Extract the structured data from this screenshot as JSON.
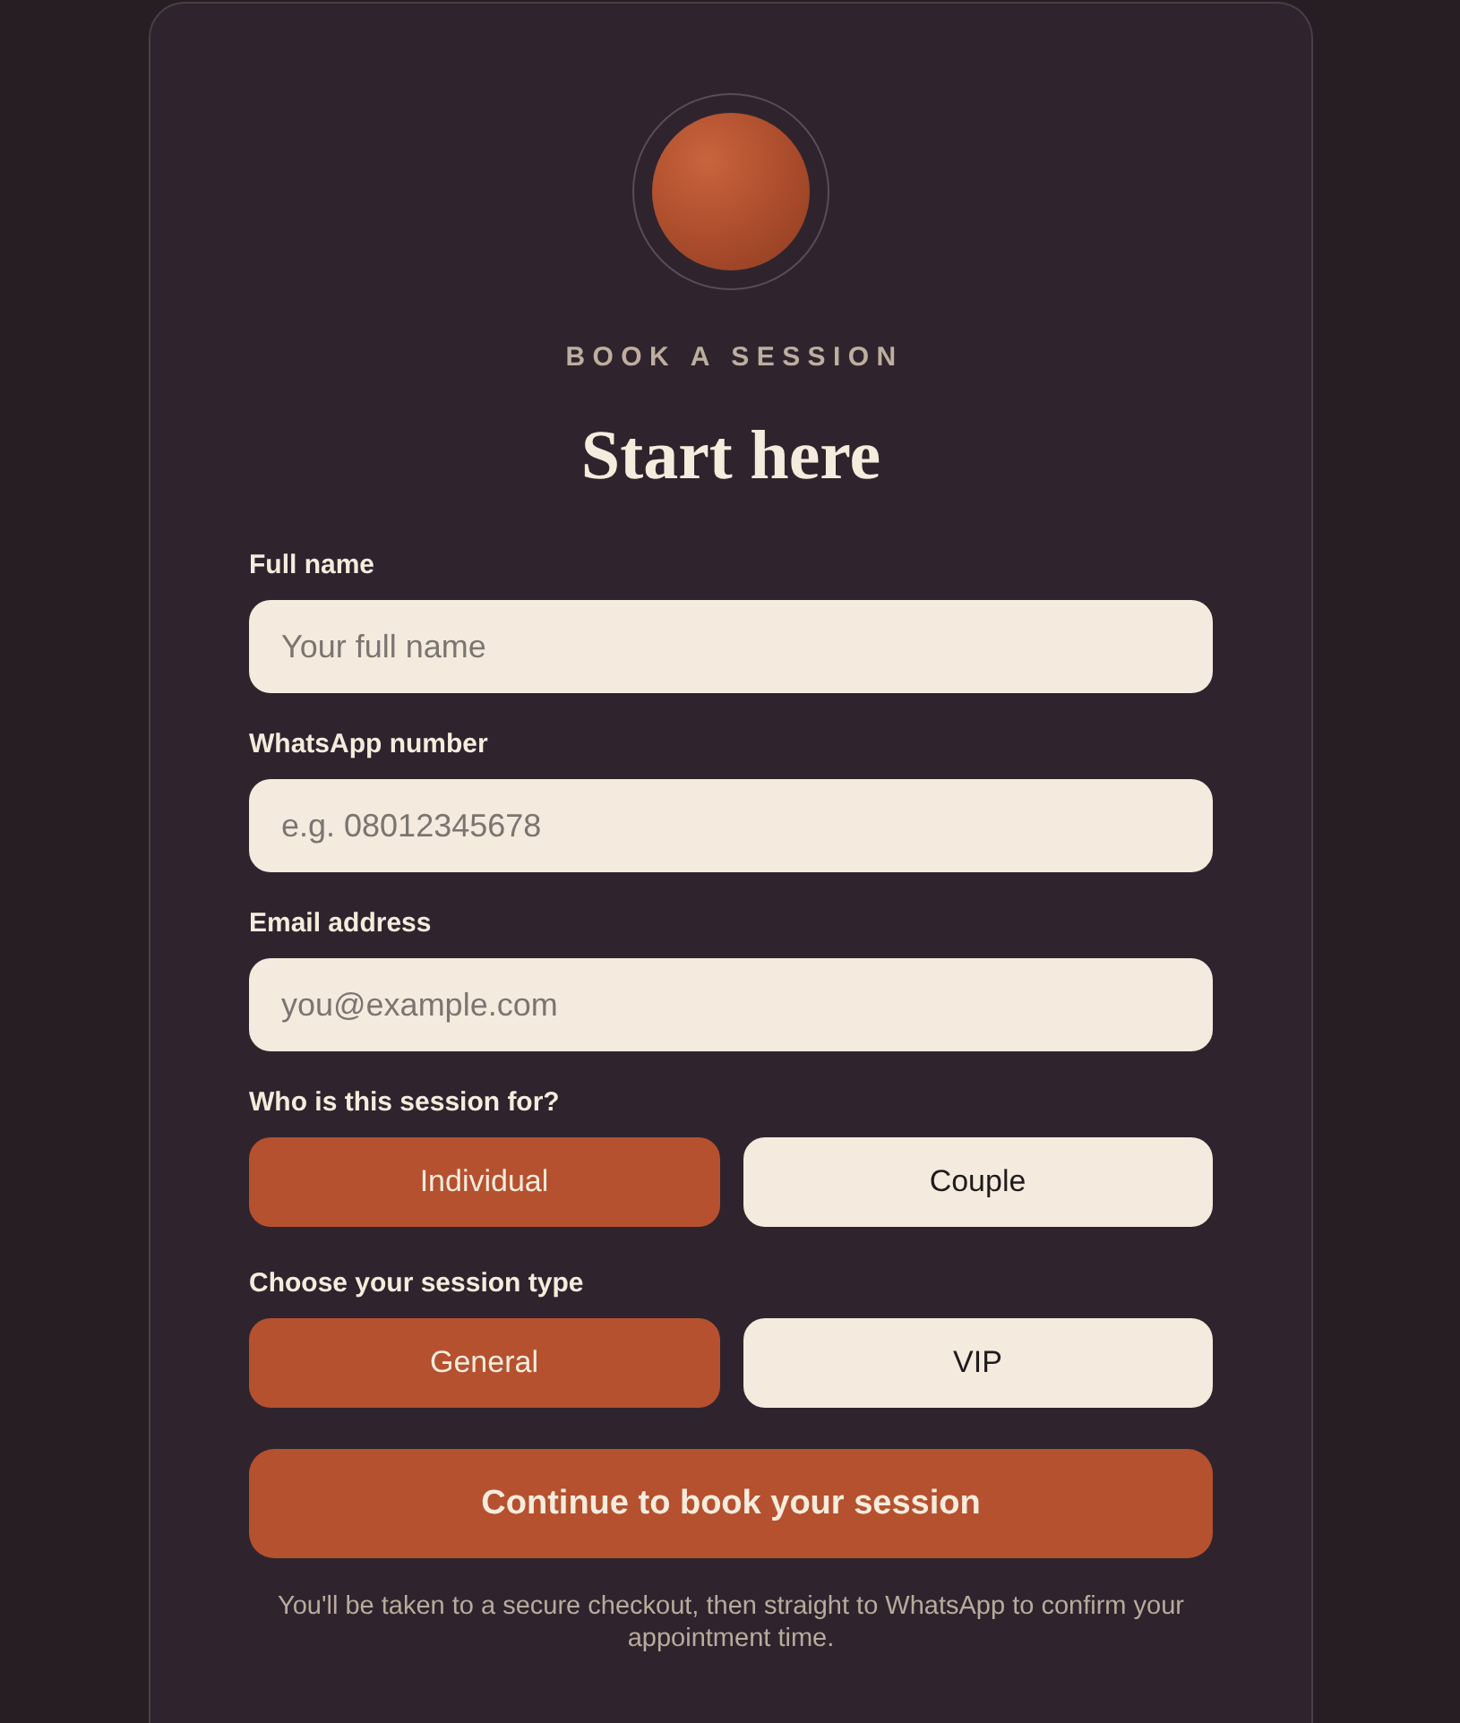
{
  "header": {
    "eyebrow": "BOOK A SESSION",
    "title": "Start here"
  },
  "fields": [
    {
      "label": "Full name",
      "placeholder": "Your full name"
    },
    {
      "label": "WhatsApp number",
      "placeholder": "e.g. 08012345678"
    },
    {
      "label": "Email address",
      "placeholder": "you@example.com"
    }
  ],
  "choices": [
    {
      "label": "Who is this session for?",
      "options": [
        {
          "label": "Individual",
          "selected": true
        },
        {
          "label": "Couple",
          "selected": false
        }
      ]
    },
    {
      "label": "Choose your session type",
      "options": [
        {
          "label": "General",
          "selected": true
        },
        {
          "label": "VIP",
          "selected": false
        }
      ]
    }
  ],
  "submit": {
    "label": "Continue to book your session"
  },
  "note": "You'll be taken to a secure checkout, then straight to WhatsApp to confirm your appointment time."
}
